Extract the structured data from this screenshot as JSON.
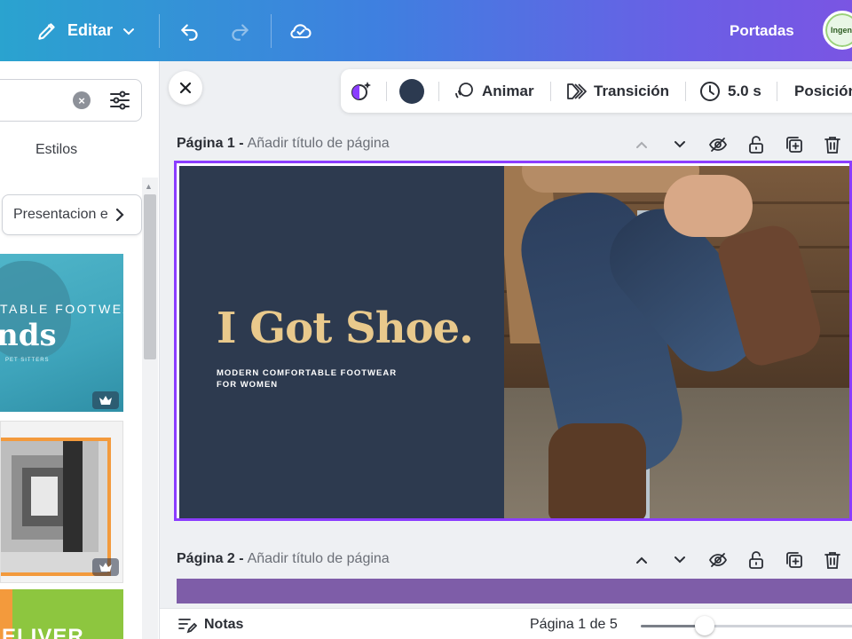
{
  "topbar": {
    "edit_label": "Editar",
    "project_title": "Portadas",
    "avatar_text": "Ingeni",
    "icons": [
      "pencil-icon",
      "chevron-down-icon",
      "undo-icon",
      "redo-icon",
      "cloud-saved-icon"
    ]
  },
  "left_panel": {
    "search": {
      "value": "",
      "placeholder": ""
    },
    "styles_label": "Estilos",
    "chip_label": "Presentacion e",
    "templates": [
      {
        "big_text": "nds",
        "small_text": "PET SITTERS",
        "overflow_text": "TABLE FOOTWEAR",
        "premium": true
      },
      {
        "premium": true
      },
      {
        "big_text": "ELIVER",
        "premium": false
      }
    ]
  },
  "context_toolbar": {
    "color_swatch": "#2c3a50",
    "animate_label": "Animar",
    "transition_label": "Transición",
    "duration_label": "5.0 s",
    "position_label": "Posición"
  },
  "pages": [
    {
      "number_label": "Página 1 -",
      "title_placeholder": "Añadir título de página"
    },
    {
      "number_label": "Página 2 -",
      "title_placeholder": "Añadir título de página"
    }
  ],
  "slide": {
    "title": "I Got Shoe.",
    "subtitle_line1": "MODERN COMFORTABLE FOOTWEAR",
    "subtitle_line2": "FOR WOMEN",
    "bg_color": "#2d3a4f",
    "title_color": "#e9c98c",
    "selection_color": "#8b3dff"
  },
  "bottom_bar": {
    "notes_label": "Notas",
    "page_indicator": "Página 1 de 5",
    "zoom_fraction": 0.3
  },
  "colors": {
    "accent": "#8b3dff",
    "page2_strip": "#7e5da8"
  }
}
